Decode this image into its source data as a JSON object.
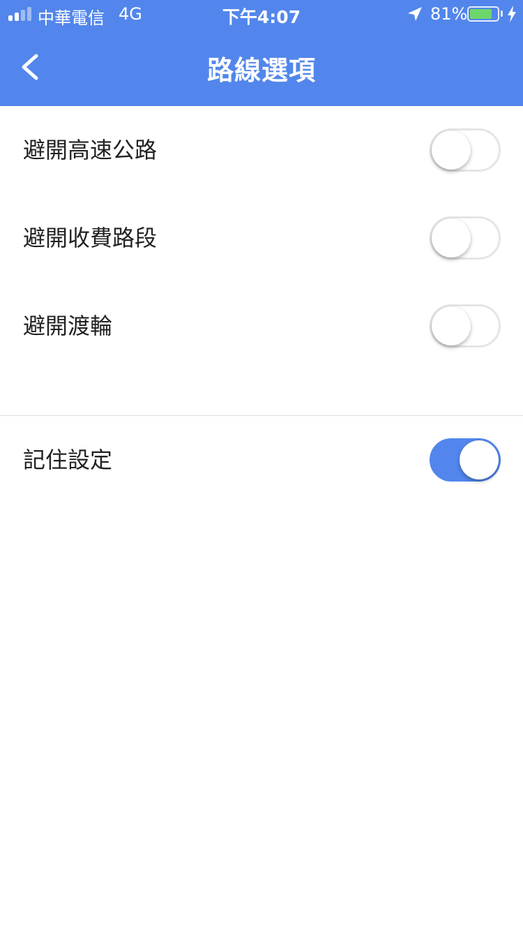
{
  "status_bar": {
    "carrier": "中華電信",
    "network": "4G",
    "time": "下午4:07",
    "battery_percent": "81%",
    "battery_level": 0.81,
    "signal_bars": 2,
    "icons": [
      "signal-icon",
      "location-arrow-icon",
      "battery-icon",
      "charging-bolt-icon"
    ]
  },
  "nav": {
    "title": "路線選項",
    "back_icon": "chevron-left-icon"
  },
  "options": [
    {
      "label": "避開高速公路",
      "enabled": false
    },
    {
      "label": "避開收費路段",
      "enabled": false
    },
    {
      "label": "避開渡輪",
      "enabled": false
    }
  ],
  "remember": {
    "label": "記住設定",
    "enabled": true
  },
  "colors": {
    "primary": "#5286EC",
    "toggle_off_border": "#E5E5E5",
    "battery_fill": "#6DD66B",
    "text": "#222222",
    "divider": "#DDDDDD"
  }
}
